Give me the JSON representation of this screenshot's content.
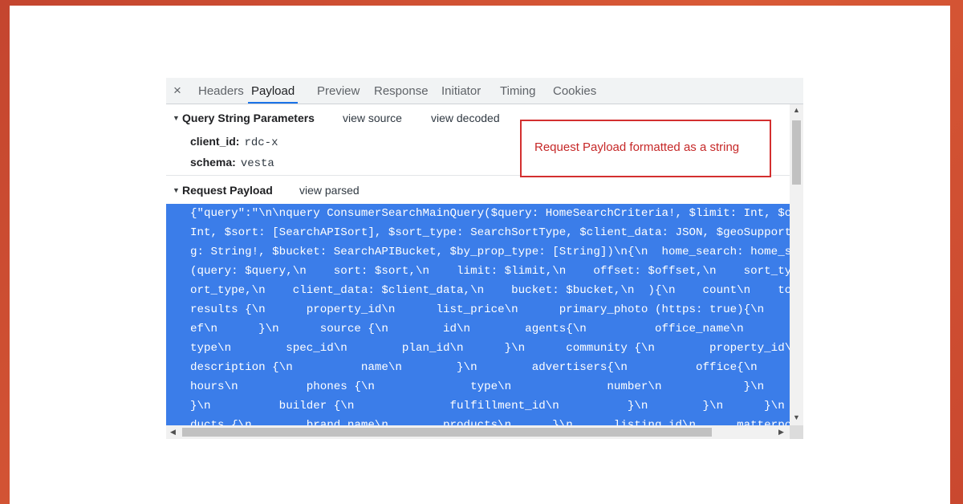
{
  "devtools": {
    "tabs": [
      "Headers",
      "Payload",
      "Preview",
      "Response",
      "Initiator",
      "Timing",
      "Cookies"
    ],
    "active_tab": "Payload",
    "close_glyph": "×"
  },
  "query_section": {
    "title": "Query String Parameters",
    "links": [
      "view source",
      "view decoded"
    ],
    "params": [
      {
        "key": "client_id:",
        "value": "rdc-x"
      },
      {
        "key": "schema:",
        "value": "vesta"
      }
    ]
  },
  "payload_section": {
    "title": "Request Payload",
    "link": "view parsed",
    "lines": [
      "{\"query\":\"\\n\\nquery ConsumerSearchMainQuery($query: HomeSearchCriteria!, $limit: Int, $offset:",
      "Int, $sort: [SearchAPISort], $sort_type: SearchSortType, $client_data: JSON, $geoSupportedSlu",
      "g: String!, $bucket: SearchAPIBucket, $by_prop_type: [String])\\n{\\n  home_search: home_search",
      "(query: $query,\\n    sort: $sort,\\n    limit: $limit,\\n    offset: $offset,\\n    sort_type: $s",
      "ort_type,\\n    client_data: $client_data,\\n    bucket: $bucket,\\n  ){\\n    count\\n    total\\n",
      "results {\\n      property_id\\n      list_price\\n      primary_photo (https: true){\\n        hr",
      "ef\\n      }\\n      source {\\n        id\\n        agents{\\n          office_name\\n        }\\n",
      "type\\n        spec_id\\n        plan_id\\n      }\\n      community {\\n        property_id\\n",
      "description {\\n          name\\n        }\\n        advertisers{\\n          office{\\n",
      "hours\\n          phones {\\n              type\\n              number\\n            }\\n",
      "}\\n          builder {\\n              fulfillment_id\\n          }\\n        }\\n      }\\n      pro",
      "ducts {\\n        brand_name\\n        products\\n      }\\n      listing_id\\n      matterport\\n"
    ]
  },
  "annotation": {
    "text": "Request Payload formatted as a string",
    "color": "#d32f2f"
  },
  "colors": {
    "selection": "#3b7de9",
    "active_tab_underline": "#1a73e8",
    "background_frame": "#c4452f"
  }
}
